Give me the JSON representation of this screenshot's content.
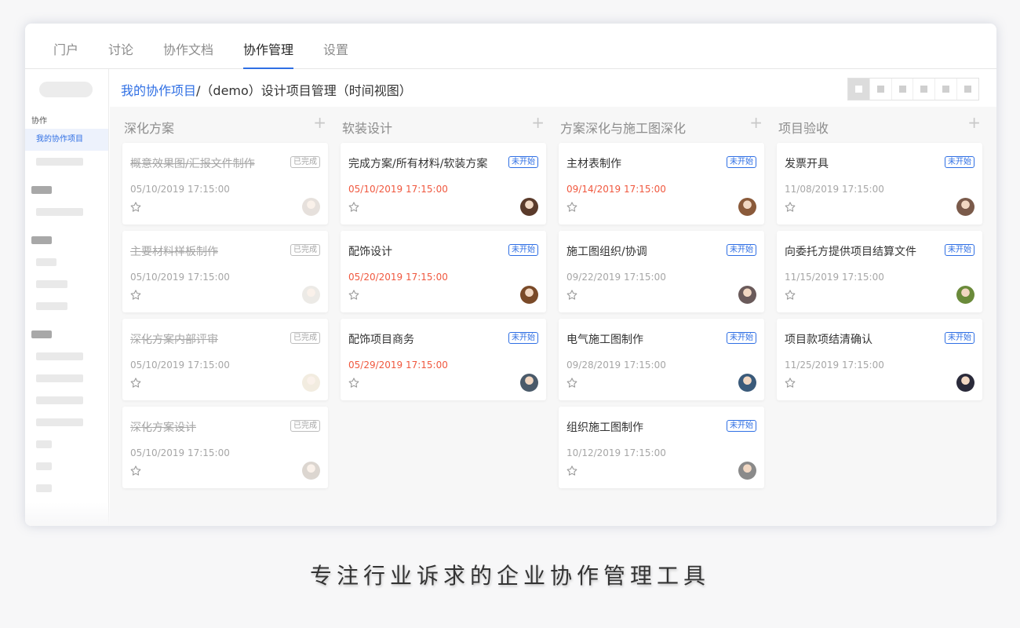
{
  "nav": {
    "tabs": [
      {
        "label": "门户"
      },
      {
        "label": "讨论"
      },
      {
        "label": "协作文档"
      },
      {
        "label": "协作管理",
        "active": true
      },
      {
        "label": "设置"
      }
    ]
  },
  "sidebar": {
    "section_label": "协作",
    "active_item": "我的协作项目"
  },
  "breadcrumb": {
    "root": "我的协作项目",
    "current": "/（demo）设计项目管理（时间视图）"
  },
  "colors": {
    "accent": "#2f6fe4",
    "overdue": "#f0583f",
    "muted": "#a6a6a6"
  },
  "board": {
    "columns": [
      {
        "title": "深化方案",
        "add_icon": "+",
        "cards": [
          {
            "title": "概意效果图/汇报文件制作",
            "date": "05/10/2019 17:15:00",
            "status": "已完成",
            "done": true,
            "overdue": false,
            "avatar": "#b8a89a"
          },
          {
            "title": "主要材料样板制作",
            "date": "05/10/2019 17:15:00",
            "status": "已完成",
            "done": true,
            "overdue": false,
            "avatar": "#c9c2b8"
          },
          {
            "title": "深化方案内部评审",
            "date": "05/10/2019 17:15:00",
            "status": "已完成",
            "done": true,
            "overdue": false,
            "avatar": "#d9c8a5"
          },
          {
            "title": "深化方案设计",
            "date": "05/10/2019 17:15:00",
            "status": "已完成",
            "done": true,
            "overdue": false,
            "avatar": "#9a8a7a"
          }
        ]
      },
      {
        "title": "软装设计",
        "add_icon": "+",
        "cards": [
          {
            "title": "完成方案/所有材料/软装方案",
            "date": "05/10/2019 17:15:00",
            "status": "未开始",
            "done": false,
            "overdue": true,
            "avatar": "#5a3a2a"
          },
          {
            "title": "配饰设计",
            "date": "05/20/2019 17:15:00",
            "status": "未开始",
            "done": false,
            "overdue": true,
            "avatar": "#7a4a28"
          },
          {
            "title": "配饰项目商务",
            "date": "05/29/2019 17:15:00",
            "status": "未开始",
            "done": false,
            "overdue": true,
            "avatar": "#4a5a6a"
          }
        ]
      },
      {
        "title": "方案深化与施工图深化",
        "add_icon": "+",
        "cards": [
          {
            "title": "主材表制作",
            "date": "09/14/2019 17:15:00",
            "status": "未开始",
            "done": false,
            "overdue": true,
            "avatar": "#8a5a3a"
          },
          {
            "title": "施工图组织/协调",
            "date": "09/22/2019 17:15:00",
            "status": "未开始",
            "done": false,
            "overdue": false,
            "avatar": "#6a5a5a"
          },
          {
            "title": "电气施工图制作",
            "date": "09/28/2019 17:15:00",
            "status": "未开始",
            "done": false,
            "overdue": false,
            "avatar": "#3a5a7a"
          },
          {
            "title": "组织施工图制作",
            "date": "10/12/2019 17:15:00",
            "status": "未开始",
            "done": false,
            "overdue": false,
            "avatar": "#8a8a8a"
          }
        ]
      },
      {
        "title": "项目验收",
        "add_icon": "+",
        "cards": [
          {
            "title": "发票开具",
            "date": "11/08/2019 17:15:00",
            "status": "未开始",
            "done": false,
            "overdue": false,
            "avatar": "#7a5a4a"
          },
          {
            "title": "向委托方提供项目结算文件",
            "date": "11/15/2019 17:15:00",
            "status": "未开始",
            "done": false,
            "overdue": false,
            "avatar": "#6a8a3a"
          },
          {
            "title": "项目款项结清确认",
            "date": "11/25/2019 17:15:00",
            "status": "未开始",
            "done": false,
            "overdue": false,
            "avatar": "#2a2a3a"
          }
        ]
      }
    ]
  },
  "tagline": "专注行业诉求的企业协作管理工具"
}
